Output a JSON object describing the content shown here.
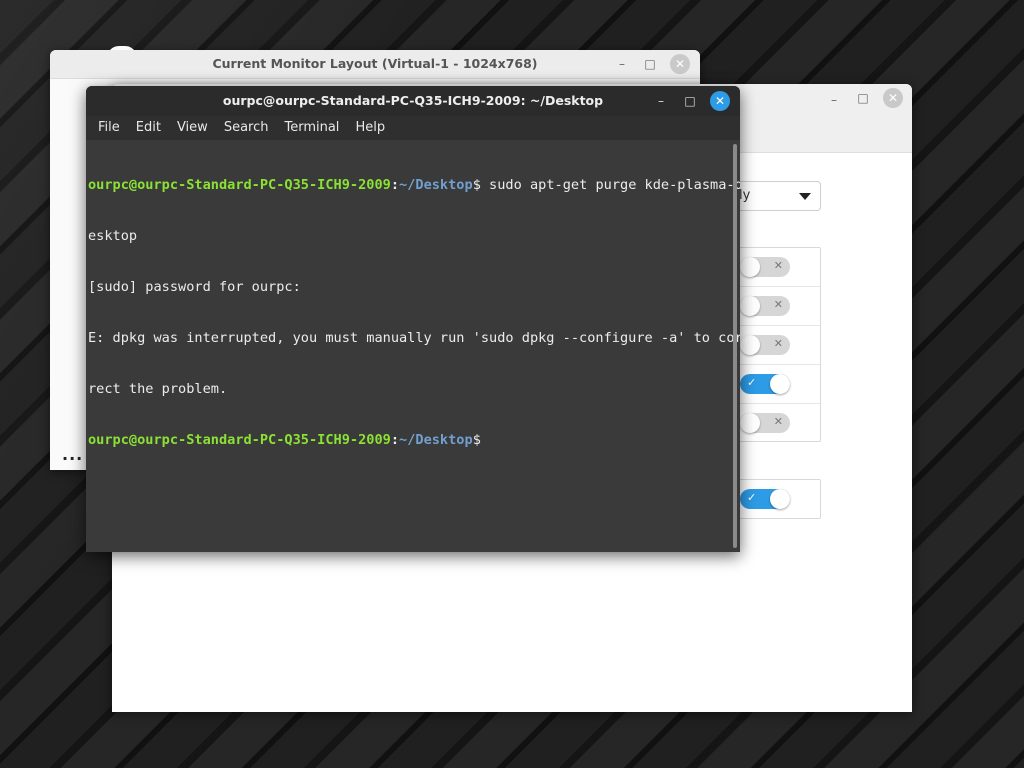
{
  "monitor_window": {
    "title": "Current Monitor Layout (Virtual-1 - 1024x768)",
    "more_label": "..."
  },
  "settings_window": {
    "combo_value_partial": "ly",
    "switch_group_1": [
      false,
      false,
      false,
      true,
      false
    ],
    "switch_group_2": [
      true
    ]
  },
  "terminal": {
    "title": "ourpc@ourpc-Standard-PC-Q35-ICH9-2009: ~/Desktop",
    "menu": [
      "File",
      "Edit",
      "View",
      "Search",
      "Terminal",
      "Help"
    ],
    "prompt_user": "ourpc@ourpc-Standard-PC-Q35-ICH9-2009",
    "prompt_path": "~/Desktop",
    "prompt_suffix": "$",
    "command_line_1": " sudo apt-get purge kde-plasma-d",
    "command_line_2": "esktop",
    "sudo_prompt": "[sudo] password for ourpc:",
    "error_line_1": "E: dpkg was interrupted, you must manually run 'sudo dpkg --configure -a' to cor",
    "error_line_2": "rect the problem."
  },
  "icons": {
    "minimize": "minimize-icon",
    "maximize": "maximize-icon",
    "close": "close-icon",
    "toggle_check": "check-icon",
    "toggle_x": "x-icon"
  },
  "colors": {
    "accent": "#2d9be6",
    "prompt_user": "#8ae234",
    "prompt_path": "#729fcf",
    "terminal_bg": "#3a3a3a"
  }
}
